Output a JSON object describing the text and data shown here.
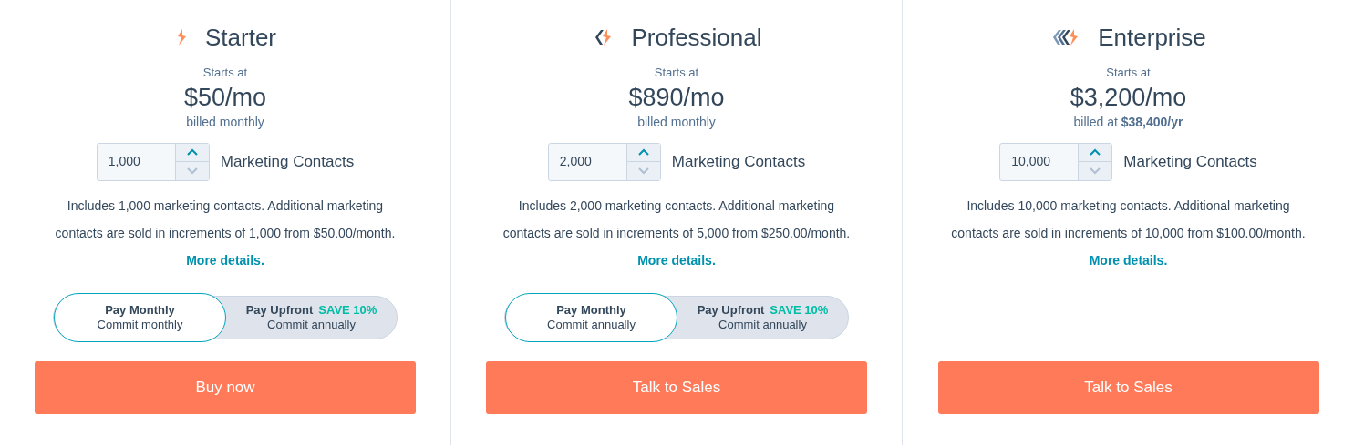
{
  "plans": [
    {
      "kind": "starter",
      "name": "Starter",
      "starts_label": "Starts at",
      "price": "$50/mo",
      "billing": "billed monthly",
      "contacts": {
        "value": "1,000",
        "label": "Marketing Contacts"
      },
      "description": "Includes 1,000 marketing contacts. Additional marketing contacts are sold in increments of 1,000 from $50.00/month.",
      "link": "More details.",
      "payment_options": [
        {
          "title": "Pay Monthly",
          "subtitle": "Commit monthly",
          "selected": true
        },
        {
          "title": "Pay Upfront",
          "badge": "SAVE 10%",
          "subtitle": "Commit annually",
          "selected": false
        }
      ],
      "button": "Buy now"
    },
    {
      "kind": "professional",
      "name": "Professional",
      "starts_label": "Starts at",
      "price": "$890/mo",
      "billing": "billed monthly",
      "contacts": {
        "value": "2,000",
        "label": "Marketing Contacts"
      },
      "description": "Includes 2,000 marketing contacts. Additional marketing contacts are sold in increments of 5,000 from $250.00/month.",
      "link": "More details.",
      "payment_options": [
        {
          "title": "Pay Monthly",
          "subtitle": "Commit annually",
          "selected": true
        },
        {
          "title": "Pay Upfront",
          "badge": "SAVE 10%",
          "subtitle": "Commit annually",
          "selected": false
        }
      ],
      "button": "Talk to Sales"
    },
    {
      "kind": "enterprise",
      "name": "Enterprise",
      "starts_label": "Starts at",
      "price": "$3,200/mo",
      "billing": "billed at **$38,400/yr**",
      "contacts": {
        "value": "10,000",
        "label": "Marketing Contacts"
      },
      "description": "Includes 10,000 marketing contacts. Additional marketing contacts are sold in increments of 10,000 from $100.00/month.",
      "link": "More details.",
      "button": "Talk to Sales"
    }
  ]
}
